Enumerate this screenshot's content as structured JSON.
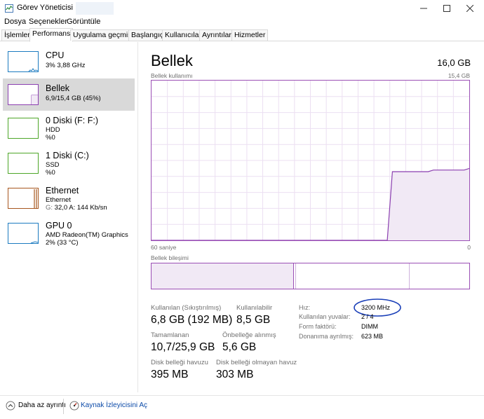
{
  "window": {
    "title": "Görev Yöneticisi"
  },
  "menu": [
    "Dosya",
    "Seçenekler",
    "Görüntüle"
  ],
  "tabs": [
    "İşlemler",
    "Performans",
    "Uygulama geçmişi",
    "Başlangıç",
    "Kullanıcılar",
    "Ayrıntılar",
    "Hizmetler"
  ],
  "sidebar": [
    {
      "title": "CPU",
      "line1": "3% 3,88 GHz",
      "line2": "",
      "color": "#1c7bc0"
    },
    {
      "title": "Bellek",
      "line1": "6,9/15,4 GB (45%)",
      "line2": "",
      "color": "#8b3fb0"
    },
    {
      "title": "0 Diski (F: F:)",
      "line1": "HDD",
      "line2": "%0",
      "color": "#4da628"
    },
    {
      "title": "1 Diski (C:)",
      "line1": "SSD",
      "line2": "%0",
      "color": "#4da628"
    },
    {
      "title": "Ethernet",
      "line1": "Ethernet",
      "line2_label": "G: ",
      "line2": "32,0 A: 144 Kb/sn",
      "color": "#a7561e"
    },
    {
      "title": "GPU 0",
      "line1": "AMD Radeon(TM) Graphics",
      "line2": "2% (33 °C)",
      "color": "#1c7bc0"
    }
  ],
  "main": {
    "title": "Bellek",
    "total": "16,0 GB",
    "usage_label": "Bellek kullanımı",
    "usage_max": "15,4 GB",
    "time_left": "60 saniye",
    "time_right": "0",
    "composition_label": "Bellek bileşimi"
  },
  "stats": {
    "in_use_label": "Kullanılan (Sıkıştırılmış)",
    "in_use_value": "6,8 GB (192 MB)",
    "available_label": "Kullanılabilir",
    "available_value": "8,5 GB",
    "committed_label": "Tamamlanan",
    "committed_value": "10,7/25,9 GB",
    "cached_label": "Önbelleğe alınmış",
    "cached_value": "5,6 GB",
    "paged_label": "Disk belleği havuzu",
    "paged_value": "395 MB",
    "nonpaged_label": "Disk belleği olmayan havuz",
    "nonpaged_value": "303 MB"
  },
  "props": [
    {
      "label": "Hız:",
      "value": "3200 MHz"
    },
    {
      "label": "Kullanılan yuvalar:",
      "value": "2 / 4"
    },
    {
      "label": "Form faktörü:",
      "value": "DIMM"
    },
    {
      "label": "Donanıma ayrılmış:",
      "value": "623 MB"
    }
  ],
  "footer": {
    "fewer_details": "Daha az ayrıntı",
    "resource_monitor": "Kaynak İzleyicisini Aç"
  },
  "memory_usage_series": [
    0,
    0,
    0,
    0,
    0,
    0,
    0,
    0,
    0,
    0,
    0,
    0,
    0,
    0,
    0,
    0,
    0,
    0,
    0,
    0,
    0,
    0,
    0,
    0,
    0,
    0,
    0,
    0,
    0,
    0,
    0,
    0,
    0,
    0,
    0,
    0,
    0,
    0,
    0,
    0,
    0,
    0,
    0,
    0,
    0,
    0,
    0,
    43,
    43,
    43,
    43,
    43,
    43,
    43,
    43,
    44,
    44,
    44,
    44,
    44,
    44,
    44,
    45
  ],
  "accent_color": "#8b3fb0"
}
